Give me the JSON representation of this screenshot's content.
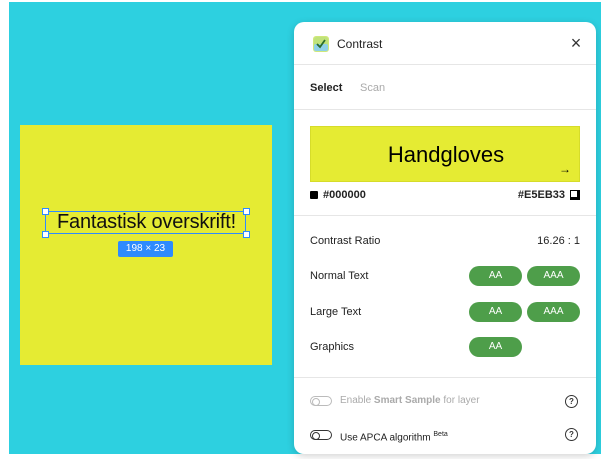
{
  "canvas": {
    "frame_text": "Fantastisk overskrift!",
    "size_badge": "198 × 23",
    "frame_color": "#E5EB33",
    "canvas_color": "#2DD0E0",
    "selection_color": "#2E8BFF"
  },
  "panel": {
    "title": "Contrast",
    "app_icon": "contrast-app-icon",
    "close_icon": "×",
    "tabs": [
      {
        "label": "Select",
        "active": true
      },
      {
        "label": "Scan",
        "active": false
      }
    ],
    "preview": {
      "text": "Handgloves",
      "arrow": "→"
    },
    "foreground": "#000000",
    "background": "#E5EB33",
    "contrast_label": "Contrast Ratio",
    "contrast_value": "16.26 : 1",
    "rows": [
      {
        "label": "Normal Text",
        "badges": [
          "AA",
          "AAA"
        ]
      },
      {
        "label": "Large Text",
        "badges": [
          "AA",
          "AAA"
        ]
      },
      {
        "label": "Graphics",
        "badges": [
          "AA"
        ]
      }
    ],
    "badge_color": "#4E9E4A",
    "options": {
      "smart_prefix": "Enable ",
      "smart_bold": "Smart Sample",
      "smart_suffix": " for layer",
      "apca_label": "Use APCA algorithm",
      "apca_sup": "Beta",
      "help": "?"
    }
  }
}
